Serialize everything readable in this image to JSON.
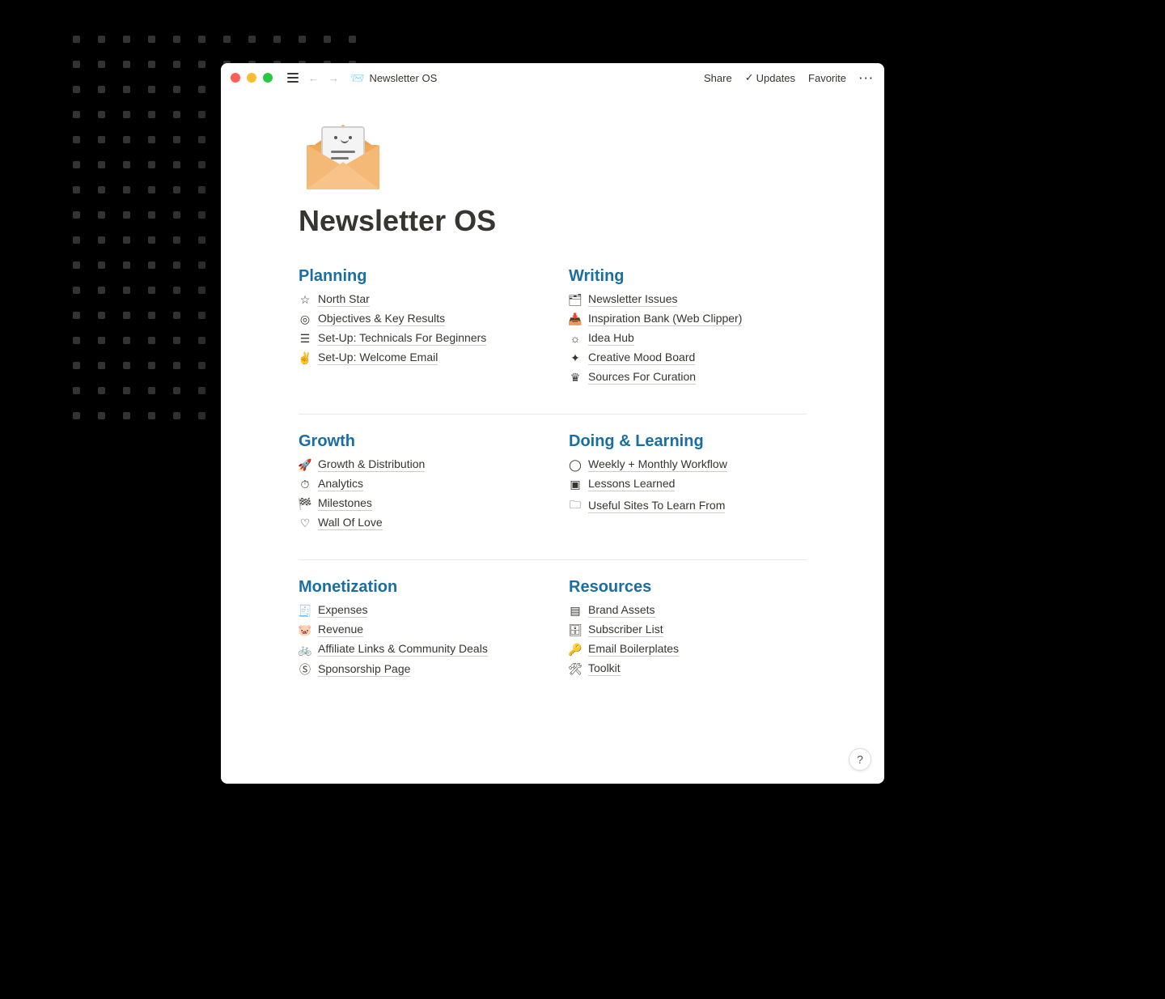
{
  "breadcrumb": {
    "icon": "📨",
    "title": "Newsletter OS"
  },
  "topbar": {
    "share": "Share",
    "updates": "Updates",
    "favorite": "Favorite"
  },
  "page": {
    "title": "Newsletter OS"
  },
  "sections": {
    "planning": {
      "heading": "Planning",
      "items": [
        {
          "icon": "☆",
          "label": "North Star"
        },
        {
          "icon": "◎",
          "label": "Objectives & Key Results"
        },
        {
          "icon": "☰",
          "label": "Set-Up: Technicals For Beginners"
        },
        {
          "icon": "✌",
          "label": "Set-Up: Welcome Email"
        }
      ]
    },
    "writing": {
      "heading": "Writing",
      "items": [
        {
          "icon": "🗂",
          "label": "Newsletter Issues"
        },
        {
          "icon": "📥",
          "label": "Inspiration Bank (Web Clipper)"
        },
        {
          "icon": "☼",
          "label": "Idea Hub"
        },
        {
          "icon": "✦",
          "label": "Creative Mood Board"
        },
        {
          "icon": "♛",
          "label": "Sources For Curation"
        }
      ]
    },
    "growth": {
      "heading": "Growth",
      "items": [
        {
          "icon": "🚀",
          "label": "Growth & Distribution"
        },
        {
          "icon": "⏱",
          "label": "Analytics"
        },
        {
          "icon": "🏁",
          "label": "Milestones"
        },
        {
          "icon": "♡",
          "label": "Wall Of Love"
        }
      ]
    },
    "doing": {
      "heading": "Doing & Learning",
      "items": [
        {
          "icon": "◯",
          "label": "Weekly + Monthly Workflow"
        },
        {
          "icon": "▣",
          "label": "Lessons Learned"
        },
        {
          "icon": "🗀",
          "label": "Useful Sites To Learn From"
        }
      ]
    },
    "monetization": {
      "heading": "Monetization",
      "items": [
        {
          "icon": "🧾",
          "label": "Expenses"
        },
        {
          "icon": "🐷",
          "label": "Revenue"
        },
        {
          "icon": "🚲",
          "label": "Affiliate Links & Community Deals"
        },
        {
          "icon": "Ⓢ",
          "label": "Sponsorship Page"
        }
      ]
    },
    "resources": {
      "heading": "Resources",
      "items": [
        {
          "icon": "▤",
          "label": "Brand Assets"
        },
        {
          "icon": "🗄",
          "label": "Subscriber List"
        },
        {
          "icon": "🔑",
          "label": "Email Boilerplates"
        },
        {
          "icon": "🛠",
          "label": "Toolkit"
        }
      ]
    }
  },
  "help": "?"
}
